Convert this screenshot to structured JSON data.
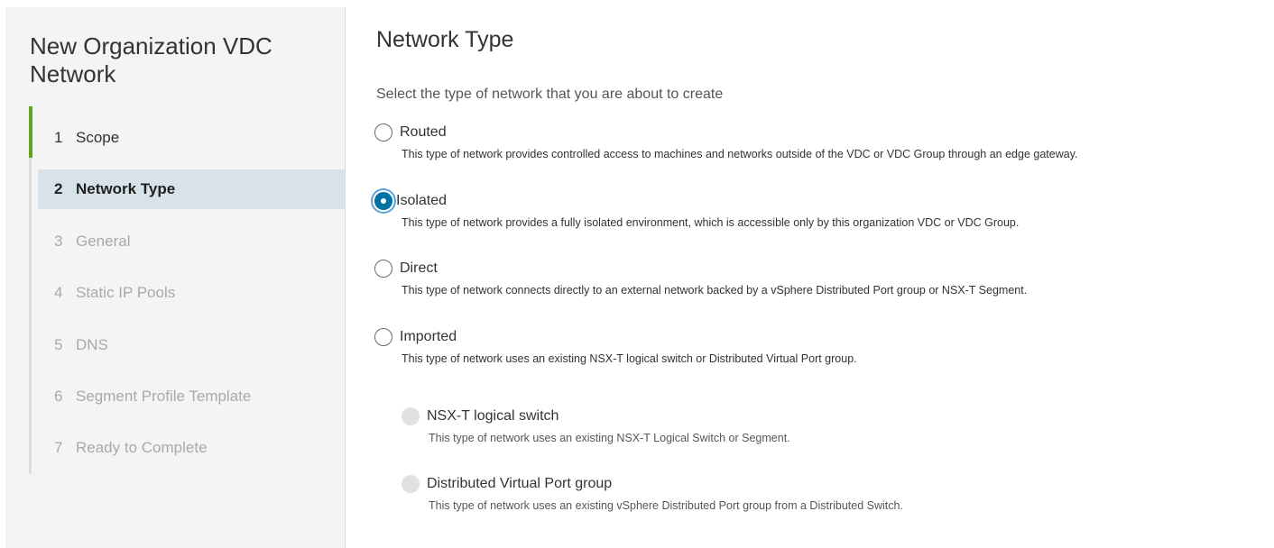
{
  "wizard": {
    "title": "New Organization VDC Network"
  },
  "steps": [
    {
      "num": "1",
      "label": "Scope",
      "state": "done"
    },
    {
      "num": "2",
      "label": "Network Type",
      "state": "active"
    },
    {
      "num": "3",
      "label": "General",
      "state": "disabled"
    },
    {
      "num": "4",
      "label": "Static IP Pools",
      "state": "disabled"
    },
    {
      "num": "5",
      "label": "DNS",
      "state": "disabled"
    },
    {
      "num": "6",
      "label": "Segment Profile Template",
      "state": "disabled"
    },
    {
      "num": "7",
      "label": "Ready to Complete",
      "state": "disabled"
    }
  ],
  "page": {
    "title": "Network Type",
    "intro": "Select the type of network that you are about to create"
  },
  "options": [
    {
      "label": "Routed",
      "description": "This type of network provides controlled access to machines and networks outside of the VDC or VDC Group through an edge gateway.",
      "checked": false
    },
    {
      "label": "Isolated",
      "description": "This type of network provides a fully isolated environment, which is accessible only by this organization VDC or VDC Group.",
      "checked": true
    },
    {
      "label": "Direct",
      "description": "This type of network connects directly to an external network backed by a vSphere Distributed Port group or NSX-T Segment.",
      "checked": false
    },
    {
      "label": "Imported",
      "description": "This type of network uses an existing NSX-T logical switch or Distributed Virtual Port group.",
      "checked": false
    }
  ],
  "sub_options": [
    {
      "label": "NSX-T logical switch",
      "description": "This type of network uses an existing NSX-T Logical Switch or Segment.",
      "enabled": false
    },
    {
      "label": "Distributed Virtual Port group",
      "description": "This type of network uses an existing vSphere Distributed Port group from a Distributed Switch.",
      "enabled": false
    }
  ],
  "colors": {
    "accent": "#0072a3",
    "completed_step": "#62a420",
    "active_step_bg": "#d8e3e9"
  }
}
